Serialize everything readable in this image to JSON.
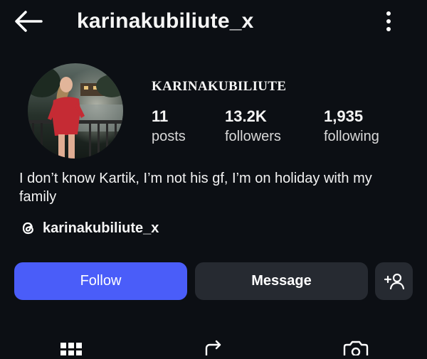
{
  "header": {
    "username": "karinakubiliute_x",
    "back_icon": "arrow-left-icon",
    "more_icon": "vertical-dots-icon"
  },
  "profile": {
    "display_name": "KARINAKUBILIUTE",
    "stats": [
      {
        "value": "11",
        "label": "posts"
      },
      {
        "value": "13.2K",
        "label": "followers"
      },
      {
        "value": "1,935",
        "label": "following"
      }
    ],
    "bio": "I don’t know Kartik, I’m not his gf, I’m on holiday with my family",
    "threads_handle": "karinakubiliute_x"
  },
  "actions": {
    "follow_label": "Follow",
    "message_label": "Message",
    "suggest_icon": "add-person-icon"
  },
  "tabs": [
    {
      "icon": "grid-icon"
    },
    {
      "icon": "reels-icon"
    },
    {
      "icon": "tagged-icon"
    }
  ],
  "colors": {
    "background": "#0c0f14",
    "follow_button": "#4a5df9",
    "secondary_button": "#262a31"
  }
}
